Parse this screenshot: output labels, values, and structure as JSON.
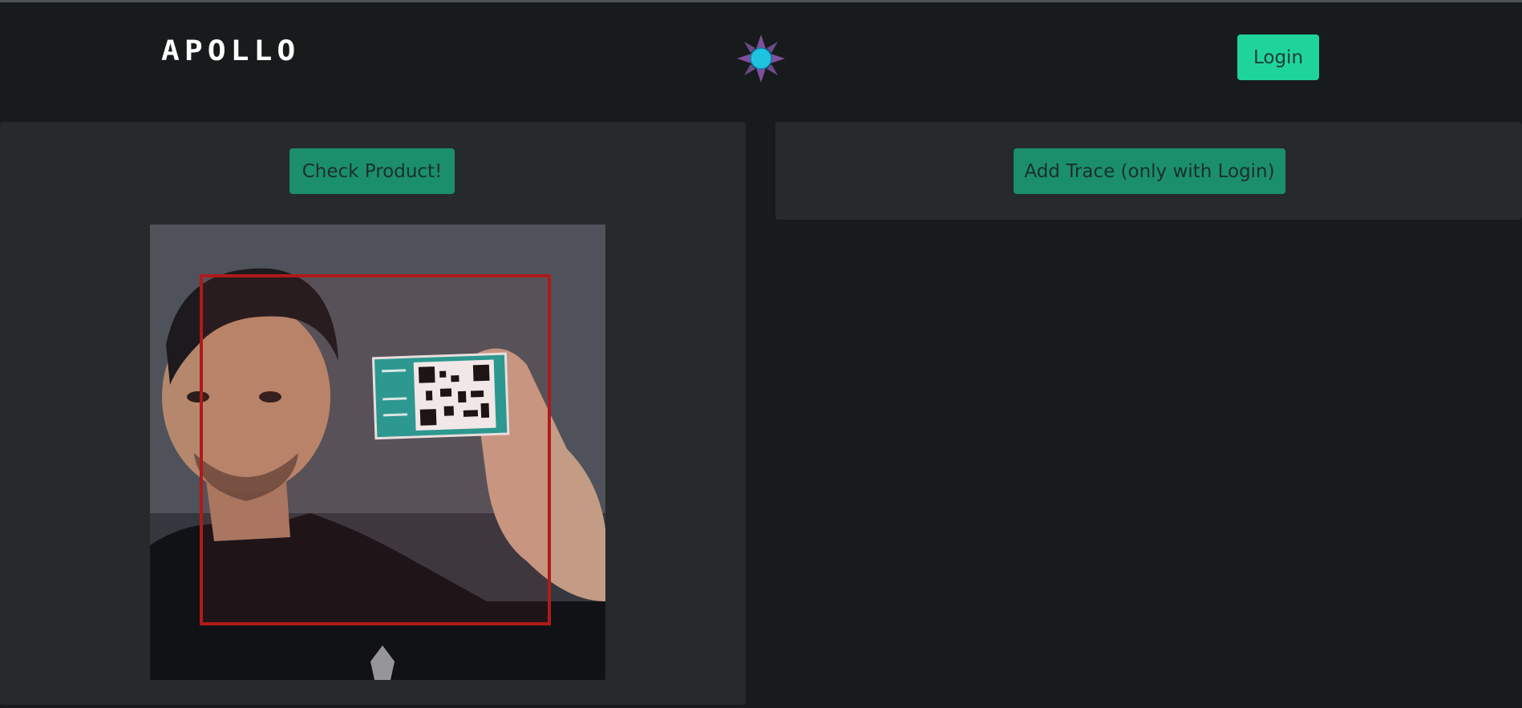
{
  "header": {
    "brand": "APOLLO",
    "logo_icon": "compass-star-icon",
    "login_label": "Login"
  },
  "left_panel": {
    "check_button_label": "Check Product!",
    "camera_feed": {
      "description_icon": "camera-feed-image",
      "scan_frame_color": "#b01a1a"
    }
  },
  "right_panel": {
    "trace_button_label": "Add Trace (only with Login)"
  },
  "colors": {
    "background": "#171b1b",
    "panel": "#262a2a",
    "accent": "#1ed49a",
    "button": "#1a8f6a"
  }
}
